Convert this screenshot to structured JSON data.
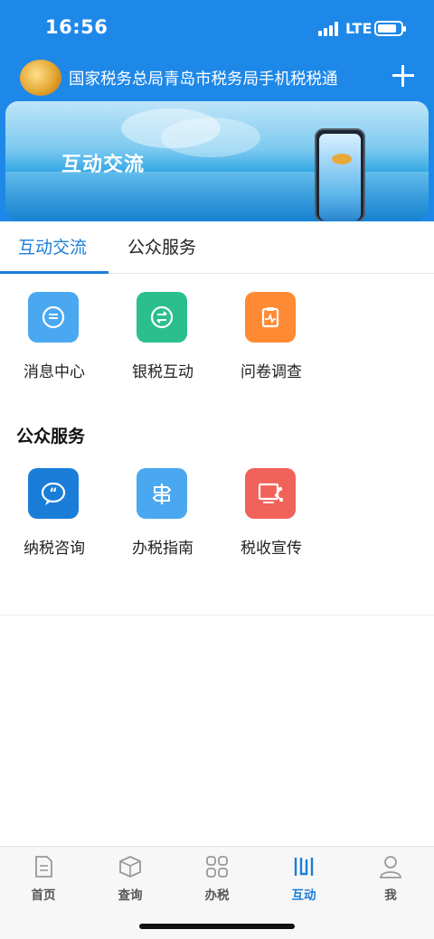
{
  "status_bar": {
    "time": "16:56",
    "network": "LTE"
  },
  "header": {
    "title": "国家税务总局青岛市税务局手机税税通"
  },
  "banner": {
    "title": "互动交流"
  },
  "tabs": [
    {
      "label": "互动交流",
      "active": true
    },
    {
      "label": "公众服务",
      "active": false
    }
  ],
  "interaction": {
    "items": [
      {
        "label": "消息中心",
        "icon": "message-icon",
        "color": "#4aa8f0"
      },
      {
        "label": "银税互动",
        "icon": "exchange-icon",
        "color": "#2bbf8e"
      },
      {
        "label": "问卷调查",
        "icon": "survey-icon",
        "color": "#ff8a34"
      }
    ]
  },
  "public_service": {
    "title": "公众服务",
    "items": [
      {
        "label": "纳税咨询",
        "icon": "quote-chat-icon",
        "color": "#1a7ed8"
      },
      {
        "label": "办税指南",
        "icon": "signpost-icon",
        "color": "#4aa8f0"
      },
      {
        "label": "税收宣传",
        "icon": "share-screen-icon",
        "color": "#f0625a"
      }
    ]
  },
  "bottom_nav": [
    {
      "label": "首页",
      "icon": "document-icon",
      "active": false
    },
    {
      "label": "查询",
      "icon": "box-icon",
      "active": false
    },
    {
      "label": "办税",
      "icon": "grid-icon",
      "active": false
    },
    {
      "label": "互动",
      "icon": "interact-icon",
      "active": true
    },
    {
      "label": "我",
      "icon": "user-icon",
      "active": false
    }
  ],
  "colors": {
    "primary": "#1e88e8",
    "active_tab": "#1a7ed8"
  }
}
